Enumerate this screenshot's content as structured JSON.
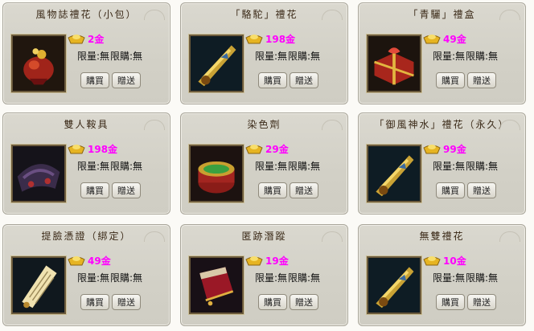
{
  "items": [
    {
      "name": "風物誌禮花（小包）",
      "price": "2金",
      "limit": "限量:無",
      "limit_buy": "限購:無",
      "buy": "購買",
      "gift": "贈送",
      "icon": "firework-bundle-icon"
    },
    {
      "name": "「駱駝」禮花",
      "price": "198金",
      "limit": "限量:無",
      "limit_buy": "限購:無",
      "buy": "購買",
      "gift": "贈送",
      "icon": "golden-scroll-icon"
    },
    {
      "name": "「青驪」禮盒",
      "price": "49金",
      "limit": "限量:無",
      "limit_buy": "限購:無",
      "buy": "購買",
      "gift": "贈送",
      "icon": "gift-box-icon"
    },
    {
      "name": "雙人鞍具",
      "price": "198金",
      "limit": "限量:無",
      "limit_buy": "限購:無",
      "buy": "購買",
      "gift": "贈送",
      "icon": "saddle-icon"
    },
    {
      "name": "染色劑",
      "price": "29金",
      "limit": "限量:無",
      "limit_buy": "限購:無",
      "buy": "購買",
      "gift": "贈送",
      "icon": "dye-jar-icon"
    },
    {
      "name": "「御風神水」禮花（永久）",
      "price": "99金",
      "limit": "限量:無",
      "limit_buy": "限購:無",
      "buy": "購買",
      "gift": "贈送",
      "icon": "golden-scroll-icon"
    },
    {
      "name": "提臉憑證（綁定）",
      "price": "49金",
      "limit": "限量:無",
      "limit_buy": "限購:無",
      "buy": "購買",
      "gift": "贈送",
      "icon": "scroll-paper-icon"
    },
    {
      "name": "匿跡潛蹤",
      "price": "19金",
      "limit": "限量:無",
      "limit_buy": "限購:無",
      "buy": "購買",
      "gift": "贈送",
      "icon": "red-pouch-icon"
    },
    {
      "name": "無雙禮花",
      "price": "10金",
      "limit": "限量:無",
      "limit_buy": "限購:無",
      "buy": "購買",
      "gift": "贈送",
      "icon": "golden-scroll-icon"
    }
  ]
}
